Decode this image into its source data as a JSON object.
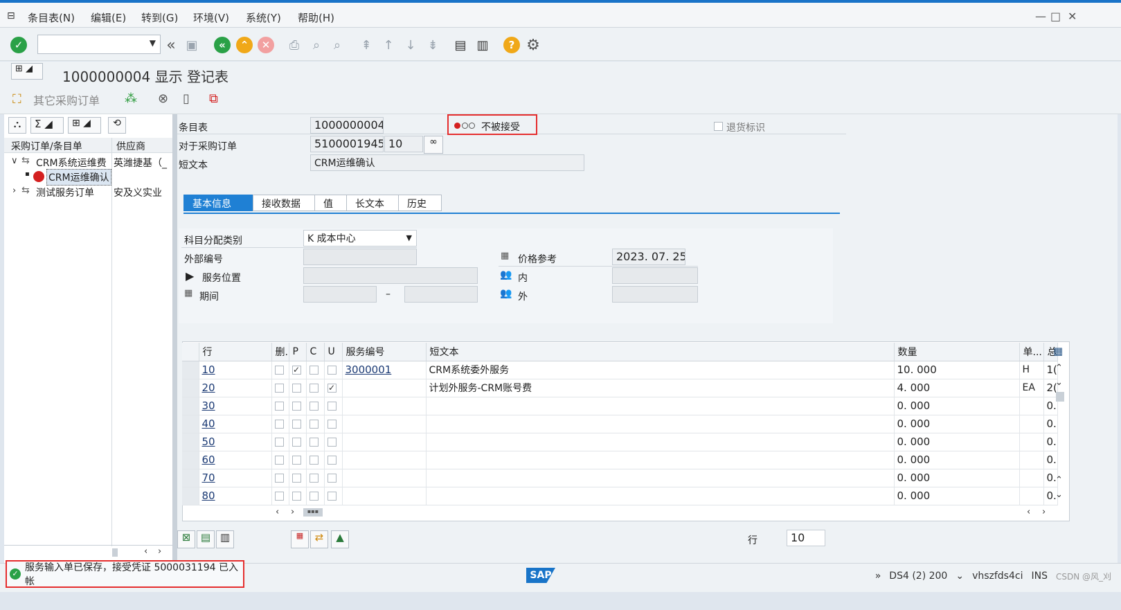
{
  "menu": {
    "items": [
      "条目表(N)",
      "编辑(E)",
      "转到(G)",
      "环境(V)",
      "系统(Y)",
      "帮助(H)"
    ]
  },
  "title": "1000000004 显示 登记表",
  "appbar": {
    "other_po": "其它采购订单"
  },
  "left_tree": {
    "col1": "采购订单/条目单",
    "col2": "供应商",
    "rows": [
      {
        "label": "CRM系统运维费",
        "vendor": "英潍捷基（_"
      },
      {
        "label": "CRM运维确认",
        "vendor": ""
      },
      {
        "label": "测试服务订单",
        "vendor": "安及义实业"
      }
    ]
  },
  "header": {
    "entry_sheet_label": "条目表",
    "entry_sheet_value": "1000000004",
    "po_label": "对于采购订单",
    "po_value": "5100001945",
    "po_item": "10",
    "short_text_label": "短文本",
    "short_text_value": "CRM运维确认",
    "status_text": "不被接受",
    "return_flag": "退货标识"
  },
  "tabs": [
    "基本信息",
    "接收数据",
    "值",
    "长文本",
    "历史"
  ],
  "basic": {
    "acct_label": "科目分配类别",
    "acct_value": "K 成本中心",
    "ext_label": "外部编号",
    "loc_label": "服务位置",
    "period_label": "期间",
    "period_sep": "–",
    "price_label": "价格参考",
    "price_value": "2023. 07. 25",
    "inner_label": "内",
    "outer_label": "外"
  },
  "table": {
    "headers": [
      "行",
      "删.",
      "P",
      "C",
      "U",
      "服务编号",
      "短文本",
      "数量",
      "单...",
      "总"
    ],
    "rows": [
      {
        "line": "10",
        "p": true,
        "u": false,
        "svc": "3000001",
        "text": "CRM系统委外服务",
        "qty": "10. 000",
        "unit": "H",
        "total": "1("
      },
      {
        "line": "20",
        "p": false,
        "u": true,
        "svc": "",
        "text": "计划外服务-CRM账号费",
        "qty": "4. 000",
        "unit": "EA",
        "total": "2("
      },
      {
        "line": "30",
        "p": false,
        "u": false,
        "svc": "",
        "text": "",
        "qty": "0. 000",
        "unit": "",
        "total": "0."
      },
      {
        "line": "40",
        "p": false,
        "u": false,
        "svc": "",
        "text": "",
        "qty": "0. 000",
        "unit": "",
        "total": "0."
      },
      {
        "line": "50",
        "p": false,
        "u": false,
        "svc": "",
        "text": "",
        "qty": "0. 000",
        "unit": "",
        "total": "0."
      },
      {
        "line": "60",
        "p": false,
        "u": false,
        "svc": "",
        "text": "",
        "qty": "0. 000",
        "unit": "",
        "total": "0."
      },
      {
        "line": "70",
        "p": false,
        "u": false,
        "svc": "",
        "text": "",
        "qty": "0. 000",
        "unit": "",
        "total": "0."
      },
      {
        "line": "80",
        "p": false,
        "u": false,
        "svc": "",
        "text": "",
        "qty": "0. 000",
        "unit": "",
        "total": "0."
      }
    ]
  },
  "bottom": {
    "line_label": "行",
    "line_value": "10"
  },
  "status": {
    "message": "服务输入单已保存，接受凭证 5000031194 已入帐",
    "system": "DS4 (2) 200",
    "host": "vhszfds4ci",
    "mode": "INS",
    "watermark": "CSDN @风_刈"
  },
  "colors": {
    "accent": "#1f80d4",
    "ok_green": "#2aa147",
    "error_red": "#d42020",
    "highlight": "#e52d2d"
  }
}
